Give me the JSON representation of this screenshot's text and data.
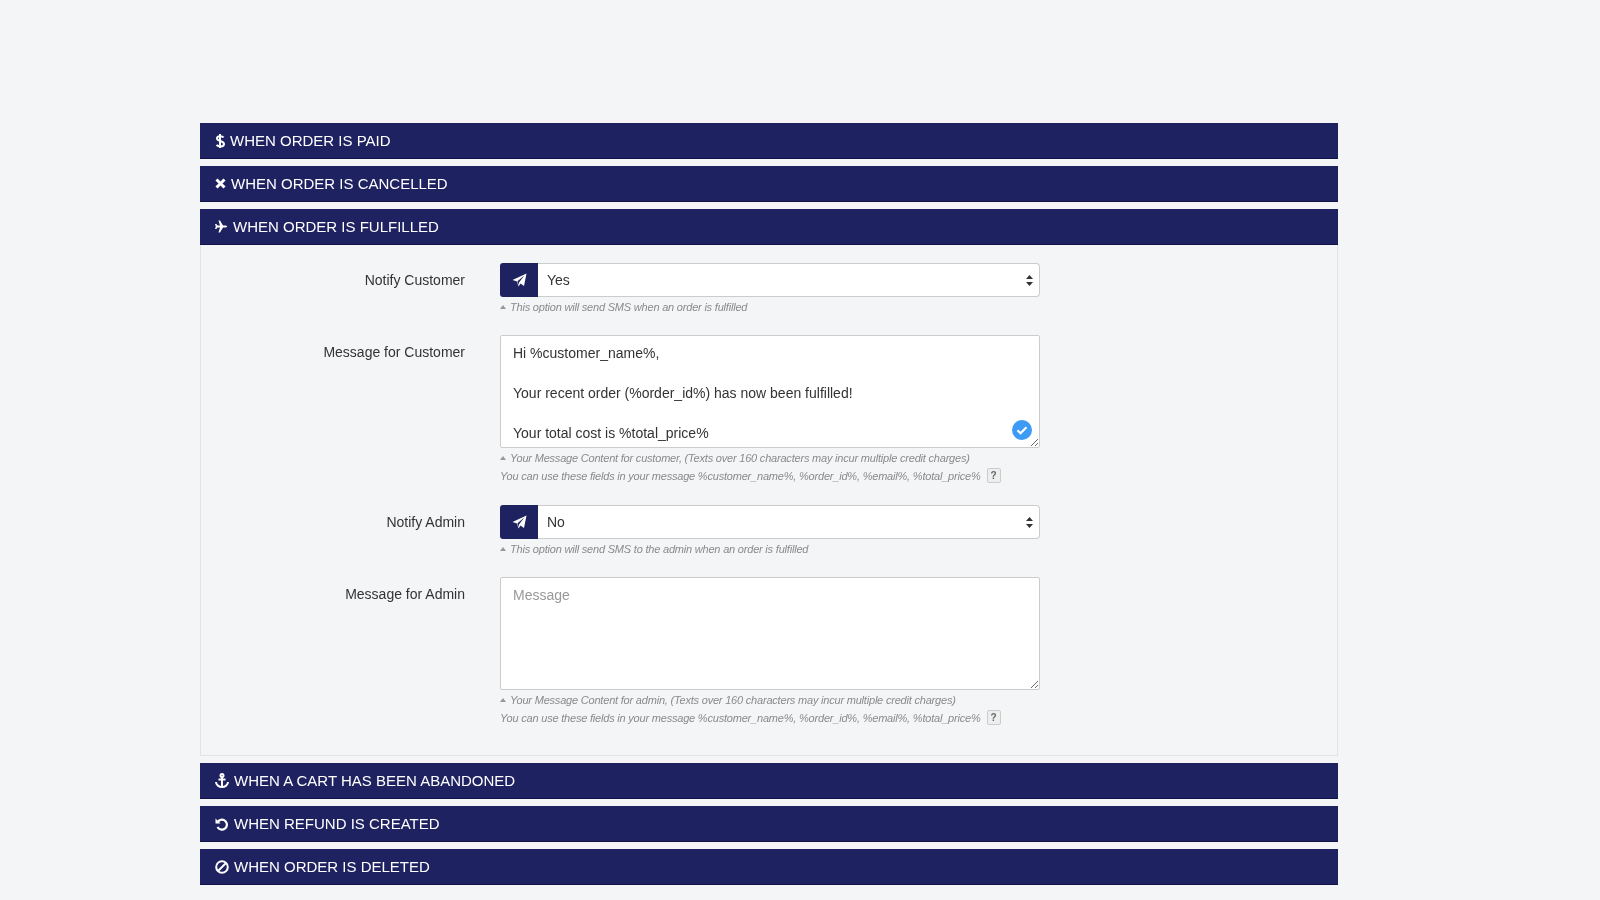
{
  "sections": [
    {
      "kind": "paid",
      "title": "WHEN ORDER IS PAID"
    },
    {
      "kind": "cancelled",
      "title": "WHEN ORDER IS CANCELLED"
    },
    {
      "kind": "fulfilled",
      "title": "WHEN ORDER IS FULFILLED",
      "fields": [
        {
          "kind": "select",
          "label": "Notify Customer",
          "value": "Yes",
          "hint": "This option will send SMS when an order is fulfilled"
        },
        {
          "kind": "textarea",
          "label": "Message for Customer",
          "value": "Hi %customer_name%,\n\nYour recent order (%order_id%) has now been fulfilled!\n\nYour total cost is %total_price%",
          "valid": true,
          "hint": "Your Message Content for customer, (Texts over 160 characters may incur multiple credit charges)",
          "note": "You can use these fields in your message %customer_name%, %order_id%, %email%, %total_price%",
          "help": "?"
        },
        {
          "kind": "select",
          "label": "Notify Admin",
          "value": "No",
          "hint": "This option will send SMS to the admin when an order is fulfilled"
        },
        {
          "kind": "textarea",
          "label": "Message for Admin",
          "placeholder": "Message",
          "valid": false,
          "hint": "Your Message Content for admin, (Texts over 160 characters may incur multiple credit charges)",
          "note": "You can use these fields in your message %customer_name%, %order_id%, %email%, %total_price%",
          "help": "?"
        }
      ]
    },
    {
      "kind": "abandoned",
      "title": "WHEN A CART HAS BEEN ABANDONED"
    },
    {
      "kind": "refund",
      "title": "WHEN REFUND IS CREATED"
    },
    {
      "kind": "deleted",
      "title": "WHEN ORDER IS DELETED"
    }
  ]
}
